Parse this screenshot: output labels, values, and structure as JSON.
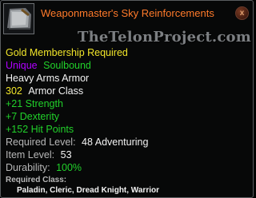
{
  "item": {
    "name": "Weaponmaster's Sky Reinforcements",
    "close_label": "x",
    "watermark": "TheTelonProject.com",
    "membership": "Gold Membership Required",
    "flags": {
      "unique": "Unique",
      "soulbound": "Soulbound"
    },
    "type": "Heavy Arms Armor",
    "armor_value": "302",
    "armor_label": "Armor Class",
    "stats": [
      "+21 Strength",
      "+7 Dexterity",
      "+152 Hit Points"
    ],
    "required_level_label": "Required Level:",
    "required_level_value": "48 Adventuring",
    "item_level_label": "Item Level:",
    "item_level_value": "53",
    "durability_label": "Durability:",
    "durability_value": "100%",
    "required_class_label": "Required Class:",
    "classes": "Paladin, Cleric, Dread Knight, Warrior",
    "icon": "armor-shoulder-icon"
  },
  "colors": {
    "title": "#ff7a2a",
    "gold": "#f2e62a",
    "unique": "#b000ff",
    "green": "#21d12a",
    "text": "#f3f3f3",
    "label": "#b7b7b7"
  }
}
